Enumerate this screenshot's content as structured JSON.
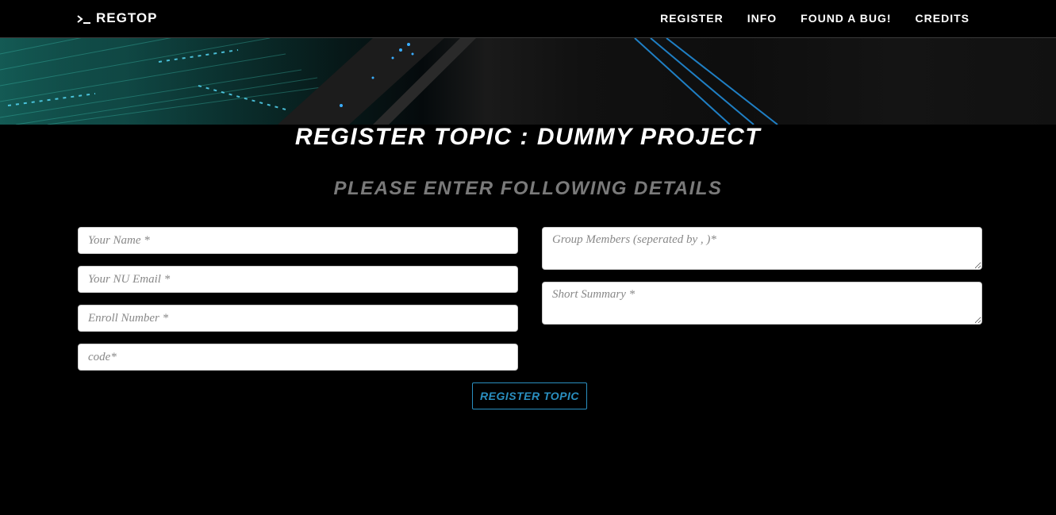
{
  "navbar": {
    "brand": "REGTOP",
    "brand_icon": "terminal-prompt-icon",
    "links": [
      "REGISTER",
      "INFO",
      "FOUND A BUG!",
      "CREDITS"
    ]
  },
  "header": {
    "title": "REGISTER TOPIC : DUMMY PROJECT",
    "subtitle": "PLEASE ENTER FOLLOWING DETAILS"
  },
  "form": {
    "name_placeholder": "Your Name *",
    "email_placeholder": "Your NU Email *",
    "enroll_placeholder": "Enroll Number *",
    "code_placeholder": "code*",
    "members_placeholder": "Group Members (seperated by , )*",
    "summary_placeholder": "Short Summary *",
    "submit_label": "REGISTER TOPIC"
  },
  "colors": {
    "background": "#000000",
    "accent": "#2a8fc0",
    "subtitle": "#7a7a7a"
  }
}
